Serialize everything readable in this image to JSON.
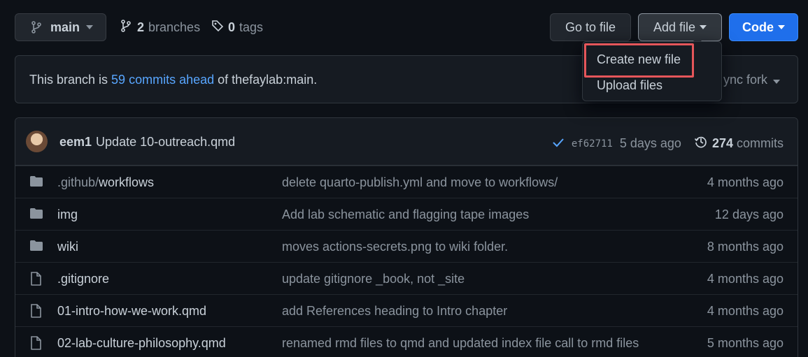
{
  "branch_selector": {
    "label": "main",
    "icon": "git-branch-icon"
  },
  "branches": {
    "count": "2",
    "label": "branches"
  },
  "tags": {
    "count": "0",
    "label": "tags"
  },
  "toolbar": {
    "goto_label": "Go to file",
    "addfile_label": "Add file",
    "code_label": "Code"
  },
  "add_file_menu": {
    "items": [
      "Create new file",
      "Upload files"
    ]
  },
  "sync": {
    "prefix": "This branch is ",
    "link": "59 commits ahead",
    "suffix": " of thefaylab:main.",
    "fork_label": "Sync fork",
    "fork_visible": "ync fork"
  },
  "last_commit": {
    "author": "eem1",
    "message": "Update 10-outreach.qmd",
    "sha": "ef62711",
    "ago": "5 days ago",
    "commit_count": "274",
    "commits_label": "commits"
  },
  "files": [
    {
      "type": "folder",
      "name_dim": ".github/",
      "name": "workflows",
      "message": "delete quarto-publish.yml and move to workflows/",
      "ago": "4 months ago"
    },
    {
      "type": "folder",
      "name_dim": "",
      "name": "img",
      "message": "Add lab schematic and flagging tape images",
      "ago": "12 days ago"
    },
    {
      "type": "folder",
      "name_dim": "",
      "name": "wiki",
      "message": "moves actions-secrets.png to wiki folder.",
      "ago": "8 months ago"
    },
    {
      "type": "file",
      "name_dim": "",
      "name": ".gitignore",
      "message": "update gitignore _book, not _site",
      "ago": "4 months ago"
    },
    {
      "type": "file",
      "name_dim": "",
      "name": "01-intro-how-we-work.qmd",
      "message": "add References heading to Intro chapter",
      "ago": "4 months ago"
    },
    {
      "type": "file",
      "name_dim": "",
      "name": "02-lab-culture-philosophy.qmd",
      "message": "renamed rmd files to qmd and updated index file call to rmd files",
      "ago": "5 months ago"
    }
  ],
  "colors": {
    "background": "#0d1117",
    "accent_link": "#58a6ff",
    "code_button": "#1f6feb",
    "highlight_box": "#e5565a"
  }
}
